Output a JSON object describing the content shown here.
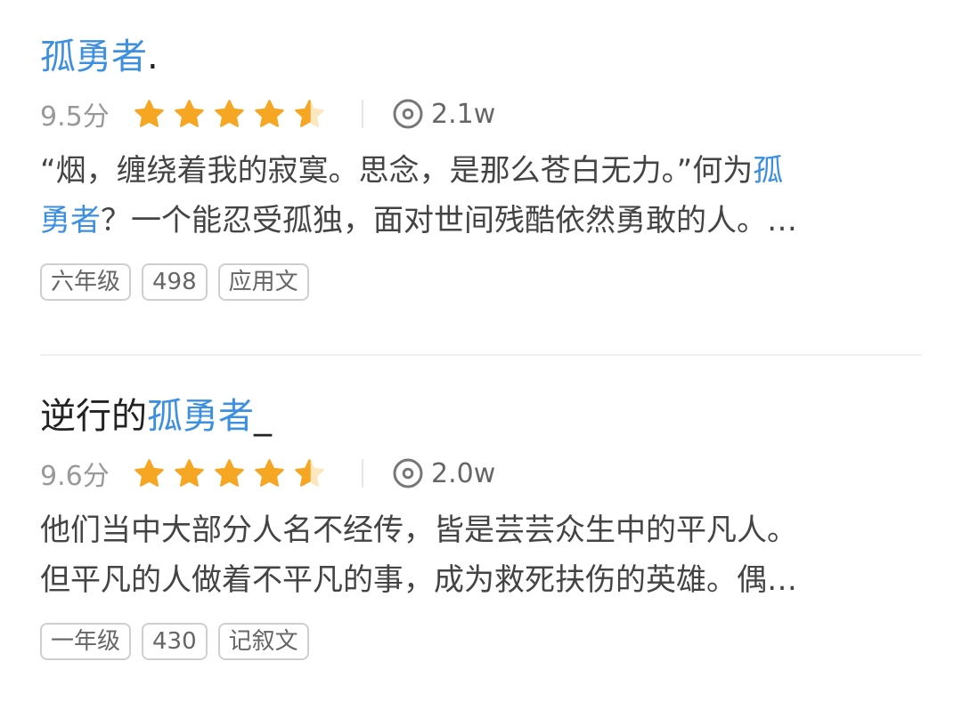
{
  "cards": [
    {
      "title_prefix": "",
      "title_highlight": "孤勇者",
      "title_suffix": ".",
      "score": "9.5分",
      "stars": 4.5,
      "views": "2.1w",
      "desc_line1_text": "“烟，缠绕着我的寂寞。思念，是那么苍白无力。”何为",
      "desc_line1_highlight": "孤",
      "desc_line2_highlight": "勇者",
      "desc_line2_text": "？一个能忍受孤独，面对世间残酷依然勇敢的人。…",
      "tags": [
        "六年级",
        "498",
        "应用文"
      ]
    },
    {
      "title_prefix": "逆行的",
      "title_highlight": "孤勇者",
      "title_suffix": "_",
      "score": "9.6分",
      "stars": 4.5,
      "views": "2.0w",
      "desc_line1_text": "他们当中大部分人名不经传，皆是芸芸众生中的平凡人。",
      "desc_line2_text": "但平凡的人做着不平凡的事，成为救死扶伤的英雄。偶…",
      "tags": [
        "一年级",
        "430",
        "记叙文"
      ]
    }
  ],
  "colors": {
    "highlight": "#3d8fe0",
    "star": "#f5a623"
  }
}
